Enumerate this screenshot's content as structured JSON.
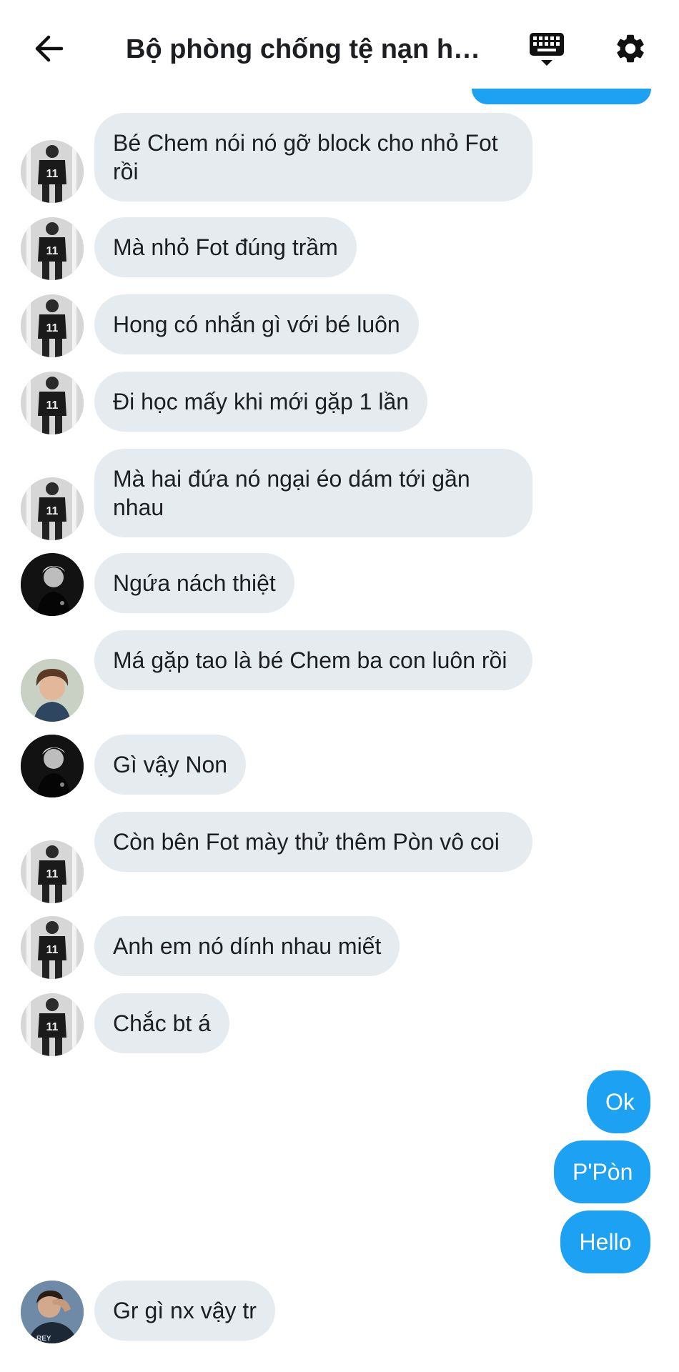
{
  "header": {
    "title": "Bộ phòng chống tệ nạn họ...",
    "back_icon": "arrow-left-icon",
    "keyboard_icon": "keyboard-icon",
    "settings_icon": "gear-icon"
  },
  "messages": [
    {
      "text": "Bé Chem nói nó gỡ block cho nhỏ Fot rồi",
      "direction": "incoming",
      "avatar": "player-jersey-bw"
    },
    {
      "text": "Mà nhỏ Fot đúng trầm",
      "direction": "incoming",
      "avatar": "player-jersey-bw"
    },
    {
      "text": "Hong có nhắn gì với bé luôn",
      "direction": "incoming",
      "avatar": "player-jersey-bw"
    },
    {
      "text": "Đi học mấy khi mới gặp 1 lần",
      "direction": "incoming",
      "avatar": "player-jersey-bw"
    },
    {
      "text": "Mà hai đứa nó ngại éo dám tới gần nhau",
      "direction": "incoming",
      "avatar": "player-jersey-bw"
    },
    {
      "text": "Ngứa nách thiệt",
      "direction": "incoming",
      "avatar": "dark-portrait"
    },
    {
      "text": "Má gặp tao là bé Chem ba con luôn rồi",
      "direction": "incoming",
      "avatar": "curly-hair-portrait"
    },
    {
      "text": "Gì vậy Non",
      "direction": "incoming",
      "avatar": "dark-portrait"
    },
    {
      "text": "Còn bên Fot mày thử thêm Pòn vô coi",
      "direction": "incoming",
      "avatar": "player-jersey-bw"
    },
    {
      "text": "Anh em nó dính nhau miết",
      "direction": "incoming",
      "avatar": "player-jersey-bw"
    },
    {
      "text": "Chắc bt á",
      "direction": "incoming",
      "avatar": "player-jersey-bw"
    },
    {
      "text": "Ok",
      "direction": "outgoing"
    },
    {
      "text": "P'Pòn",
      "direction": "outgoing"
    },
    {
      "text": "Hello",
      "direction": "outgoing"
    },
    {
      "text": "Gr gì nx vậy tr",
      "direction": "incoming",
      "avatar": "hand-over-face-portrait"
    }
  ],
  "colors": {
    "outgoing_bubble": "#1da1f2",
    "incoming_bubble": "#e6ebf0",
    "text": "#1c1e21"
  }
}
